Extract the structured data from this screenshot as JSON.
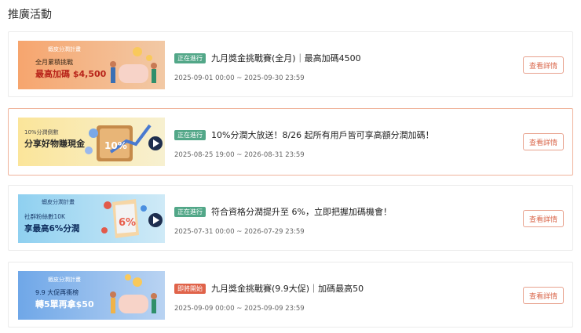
{
  "page_title": "推廣活動",
  "view_details_label": "查看詳情",
  "campaigns": [
    {
      "status": "正在進行",
      "title": "九月獎金挑戰賽(全月)｜最高加碼4500",
      "date": "2025-09-01 00:00 ~ 2025-09-30 23:59",
      "banner": {
        "logo": "蝦皮分潤計畫",
        "line1": "全月累積挑戰",
        "line2": "最高加碼 $4,500"
      }
    },
    {
      "status": "正在進行",
      "title": "10%分潤大放送！8/26 起所有用戶皆可享高額分潤加碼！",
      "date": "2025-08-25 19:00 ~ 2026-08-31 23:59",
      "banner": {
        "line1": "10%分潤倒數",
        "line2": "分享好物賺現金",
        "badge": "10%"
      }
    },
    {
      "status": "正在進行",
      "title": "符合資格分潤提升至 6%，立即把握加碼機會！",
      "date": "2025-07-31 00:00 ~ 2026-07-29 23:59",
      "banner": {
        "logo": "蝦皮分潤計畫",
        "line1": "社群粉絲數10K",
        "line2": "享最高6%分潤",
        "badge": "6%"
      }
    },
    {
      "status": "即將開始",
      "title": "九月獎金挑戰賽(9.9大促)｜加碼最高50",
      "date": "2025-09-09 00:00 ~ 2025-09-09 23:59",
      "banner": {
        "logo": "蝦皮分潤計畫",
        "line1": "9.9 大促再衝榜",
        "line2": "轉5單再拿$50"
      }
    }
  ]
}
